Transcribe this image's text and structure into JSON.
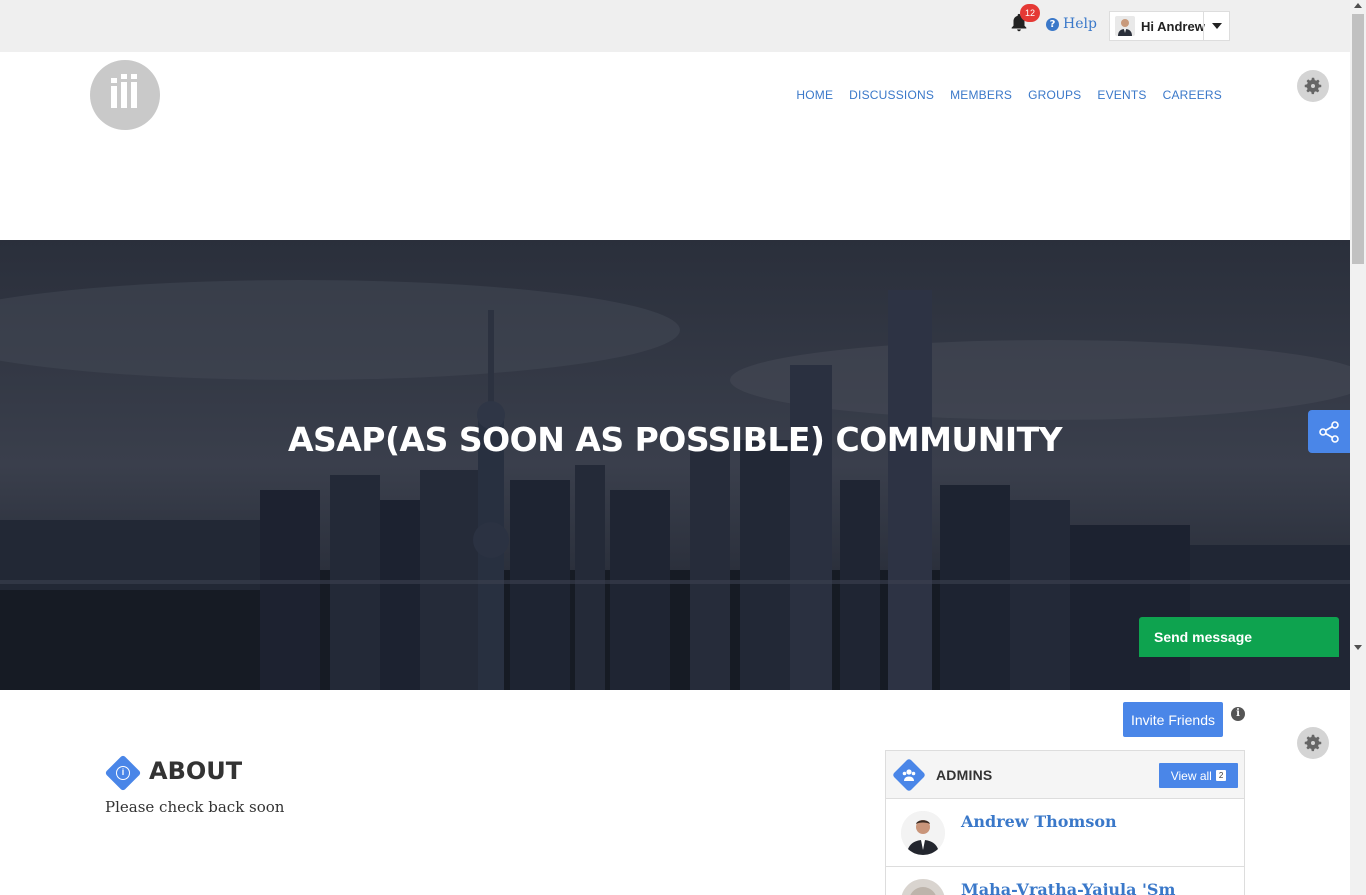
{
  "topbar": {
    "notification_count": "12",
    "help_label": "Help",
    "greeting": "Hi Andrew"
  },
  "nav": {
    "items": [
      "HOME",
      "DISCUSSIONS",
      "MEMBERS",
      "GROUPS",
      "EVENTS",
      "CAREERS"
    ]
  },
  "hero": {
    "title": "ASAP(AS SOON AS POSSIBLE) COMMUNITY"
  },
  "actions": {
    "send_message": "Send message",
    "invite_friends": "Invite Friends"
  },
  "about": {
    "title": "ABOUT",
    "text": "Please check back soon"
  },
  "admins": {
    "title": "ADMINS",
    "view_all": "View all",
    "count": "2",
    "members": [
      "Andrew Thomson",
      "Maha-Vratha-Yajula 'Sm"
    ]
  },
  "colors": {
    "accent": "#4a86e8",
    "link": "#3a78c9",
    "send_button": "#0ea34f",
    "badge": "#e53935"
  }
}
